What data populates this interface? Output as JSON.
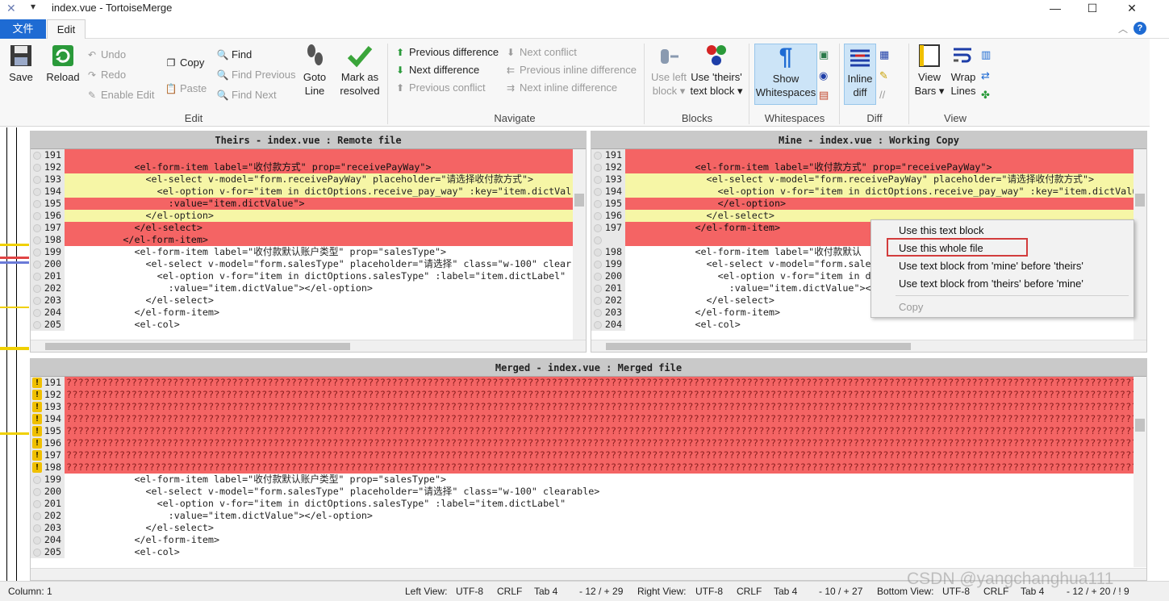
{
  "titlebar": {
    "title": "index.vue - TortoiseMerge",
    "qa": "▾",
    "minimize": "—",
    "maximize": "☐",
    "close": "✕"
  },
  "tabs": {
    "file": "文件",
    "edit": "Edit"
  },
  "ribbon": {
    "save": "Save",
    "reload": "Reload",
    "undo": "Undo",
    "redo": "Redo",
    "enable_edit": "Enable Edit",
    "copy": "Copy",
    "paste": "Paste",
    "group_edit": "Edit",
    "find": "Find",
    "find_previous": "Find Previous",
    "find_next": "Find Next",
    "goto": "Goto",
    "goto2": "Line",
    "mark": "Mark as",
    "mark2": "resolved",
    "prev_diff": "Previous difference",
    "next_diff": "Next difference",
    "prev_conflict": "Previous conflict",
    "next_conflict": "Next conflict",
    "prev_inline": "Previous inline difference",
    "next_inline": "Next inline difference",
    "group_navigate": "Navigate",
    "use_left": "Use left",
    "use_left2": "block",
    "use_theirs": "Use 'theirs'",
    "use_theirs2": "text block",
    "group_blocks": "Blocks",
    "show": "Show",
    "show2": "Whitespaces",
    "group_whitespaces": "Whitespaces",
    "inline": "Inline",
    "inline2": "diff",
    "group_diff": "Diff",
    "view": "View",
    "view2": "Bars",
    "wrap": "Wrap",
    "wrap2": "Lines",
    "group_view": "View"
  },
  "theirs": {
    "header": "Theirs - index.vue : Remote file",
    "lines": [
      {
        "n": "191",
        "t": "",
        "c": "red"
      },
      {
        "n": "192",
        "t": "            <el-form-item label=\"收付款方式\" prop=\"receivePayWay\">",
        "c": "red"
      },
      {
        "n": "193",
        "t": "              <el-select v-model=\"form.receivePayWay\" placeholder=\"请选择收付款方式\">",
        "c": "yellow"
      },
      {
        "n": "194",
        "t": "                <el-option v-for=\"item in dictOptions.receive_pay_way\" :key=\"item.dictVal",
        "c": "yellow"
      },
      {
        "n": "195",
        "t": "                  :value=\"item.dictValue\">",
        "c": "red"
      },
      {
        "n": "196",
        "t": "              </el-option>",
        "c": "yellow"
      },
      {
        "n": "197",
        "t": "            </el-select>",
        "c": "red"
      },
      {
        "n": "198",
        "t": "          </el-form-item>",
        "c": "red"
      },
      {
        "n": "199",
        "t": "            <el-form-item label=\"收付款默认账户类型\" prop=\"salesType\">",
        "c": "n"
      },
      {
        "n": "200",
        "t": "              <el-select v-model=\"form.salesType\" placeholder=\"请选择\" class=\"w-100\" clear",
        "c": "n"
      },
      {
        "n": "201",
        "t": "                <el-option v-for=\"item in dictOptions.salesType\" :label=\"item.dictLabel\"",
        "c": "n"
      },
      {
        "n": "202",
        "t": "                  :value=\"item.dictValue\"></el-option>",
        "c": "n"
      },
      {
        "n": "203",
        "t": "              </el-select>",
        "c": "n"
      },
      {
        "n": "204",
        "t": "            </el-form-item>",
        "c": "n"
      },
      {
        "n": "205",
        "t": "            <el-col>",
        "c": "n"
      }
    ]
  },
  "mine": {
    "header": "Mine - index.vue : Working Copy",
    "lines": [
      {
        "n": "191",
        "t": "",
        "c": "red"
      },
      {
        "n": "192",
        "t": "            <el-form-item label=\"收付款方式\" prop=\"receivePayWay\">",
        "c": "red"
      },
      {
        "n": "193",
        "t": "              <el-select v-model=\"form.receivePayWay\" placeholder=\"请选择收付款方式\">",
        "c": "yellow"
      },
      {
        "n": "194",
        "t": "                <el-option v-for=\"item in dictOptions.receive_pay_way\" :key=\"item.dictValue",
        "c": "yellow"
      },
      {
        "n": "195",
        "t": "                </el-option>",
        "c": "red"
      },
      {
        "n": "196",
        "t": "              </el-select>",
        "c": "yellow"
      },
      {
        "n": "197",
        "t": "            </el-form-item>",
        "c": "red"
      },
      {
        "n": "",
        "t": "",
        "c": "red"
      },
      {
        "n": "198",
        "t": "            <el-form-item label=\"收付款默认",
        "c": "n"
      },
      {
        "n": "199",
        "t": "              <el-select v-model=\"form.sale",
        "c": "n"
      },
      {
        "n": "200",
        "t": "                <el-option v-for=\"item in d",
        "c": "n"
      },
      {
        "n": "201",
        "t": "                  :value=\"item.dictValue\"><",
        "c": "n"
      },
      {
        "n": "202",
        "t": "              </el-select>",
        "c": "n"
      },
      {
        "n": "203",
        "t": "            </el-form-item>",
        "c": "n"
      },
      {
        "n": "204",
        "t": "            <el-col>",
        "c": "n"
      }
    ]
  },
  "merged": {
    "header": "Merged - index.vue : Merged file",
    "qline": "????????????????????????????????????????????????????????????????????????????????????????????????????????????????????????????????????????????????????????????????????????????????????????????????????????",
    "lines": [
      {
        "n": "191",
        "c": "q"
      },
      {
        "n": "192",
        "c": "q"
      },
      {
        "n": "193",
        "c": "q"
      },
      {
        "n": "194",
        "c": "q"
      },
      {
        "n": "195",
        "c": "q"
      },
      {
        "n": "196",
        "c": "q"
      },
      {
        "n": "197",
        "c": "q"
      },
      {
        "n": "198",
        "c": "q"
      },
      {
        "n": "199",
        "t": "            <el-form-item label=\"收付款默认账户类型\" prop=\"salesType\">",
        "c": "n"
      },
      {
        "n": "200",
        "t": "              <el-select v-model=\"form.salesType\" placeholder=\"请选择\" class=\"w-100\" clearable>",
        "c": "n"
      },
      {
        "n": "201",
        "t": "                <el-option v-for=\"item in dictOptions.salesType\" :label=\"item.dictLabel\"",
        "c": "n"
      },
      {
        "n": "202",
        "t": "                  :value=\"item.dictValue\"></el-option>",
        "c": "n"
      },
      {
        "n": "203",
        "t": "              </el-select>",
        "c": "n"
      },
      {
        "n": "204",
        "t": "            </el-form-item>",
        "c": "n"
      },
      {
        "n": "205",
        "t": "            <el-col>",
        "c": "n"
      }
    ]
  },
  "context_menu": {
    "items": [
      "Use this text block",
      "Use this whole file",
      "Use text block from 'mine' before 'theirs'",
      "Use text block from 'theirs' before 'mine'",
      "Copy"
    ]
  },
  "status": {
    "column": "Column: 1",
    "left_view": "Left View:",
    "left_enc": "UTF-8",
    "left_eol": "CRLF",
    "left_tab": "Tab 4",
    "left_cnt": "- 12 / + 29",
    "right_view": "Right View:",
    "right_enc": "UTF-8",
    "right_eol": "CRLF",
    "right_tab": "Tab 4",
    "right_cnt": "- 10 / + 27",
    "bottom_view": "Bottom View:",
    "bottom_enc": "UTF-8",
    "bottom_eol": "CRLF",
    "bottom_tab": "Tab 4",
    "bottom_cnt": "- 12 / + 20 / ! 9"
  },
  "watermark": "CSDN @yangchanghua111"
}
